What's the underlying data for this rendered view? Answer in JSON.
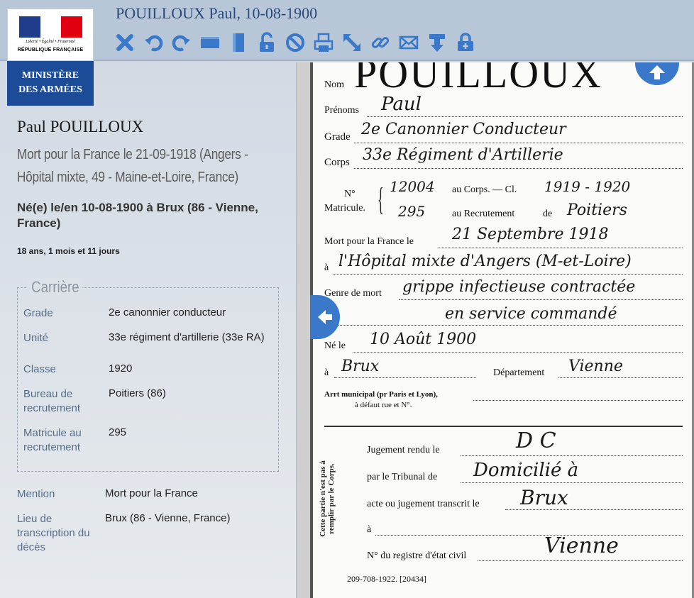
{
  "header": {
    "title": "POUILLOUX Paul, 10-08-1900",
    "tools": [
      {
        "name": "close-icon",
        "color": "#3a78c9"
      },
      {
        "name": "rotate-left-icon",
        "color": "#3a78c9"
      },
      {
        "name": "rotate-right-icon",
        "color": "#3a78c9"
      },
      {
        "name": "fit-width-icon",
        "color": "#3a78c9"
      },
      {
        "name": "fit-height-icon",
        "color": "#3a78c9"
      },
      {
        "name": "unlock-icon",
        "color": "#3a78c9"
      },
      {
        "name": "block-icon",
        "color": "#3a78c9"
      },
      {
        "name": "print-icon",
        "color": "#3a78c9"
      },
      {
        "name": "expand-icon",
        "color": "#3a78c9"
      },
      {
        "name": "link-icon",
        "color": "#3a78c9"
      },
      {
        "name": "mail-icon",
        "color": "#3a78c9"
      },
      {
        "name": "download-icon",
        "color": "#3a78c9"
      },
      {
        "name": "lock-add-icon",
        "color": "#3a78c9"
      }
    ]
  },
  "logo": {
    "motto": "Liberté • Égalité • Fraternité",
    "republic": "RÉPUBLIQUE FRANÇAISE",
    "ministry_line1": "MINISTÈRE",
    "ministry_line2": "DES ARMÉES"
  },
  "person": {
    "name": "Paul POUILLOUX",
    "mort": "Mort pour la France le 21-09-1918 (Angers - Hôpital mixte, 49 - Maine-et-Loire, France)",
    "naissance": "Né(e) le/en 10-08-1900 à Brux (86 - Vienne, France)",
    "age": "18 ans, 1 mois et 11 jours"
  },
  "carriere": {
    "title": "Carrière",
    "rows": [
      {
        "label": "Grade",
        "value": "2e canonnier conducteur"
      },
      {
        "label": "Unité",
        "value": "33e régiment d'artillerie (33e RA)"
      },
      {
        "label": "Classe",
        "value": "1920"
      },
      {
        "label": "Bureau de recrutement",
        "value": "Poitiers (86)"
      },
      {
        "label": "Matricule au recrutement",
        "value": "295"
      }
    ]
  },
  "extra": [
    {
      "label": "Mention",
      "value": "Mort pour la France"
    },
    {
      "label": "Lieu de transcription du décès",
      "value": "Brux (86 - Vienne, France)"
    }
  ],
  "document": {
    "nom_label": "Nom",
    "nom_value": "POUILLOUX",
    "prenoms_label": "Prénoms",
    "prenoms_value": "Paul",
    "grade_label": "Grade",
    "grade_value": "2e Canonnier Conducteur",
    "corps_label": "Corps",
    "corps_value": "33e Régiment d'Artillerie",
    "no_label": "N°",
    "matricule_label": "Matricule.",
    "corps_no": "12004",
    "au_corps": "au Corps. — Cl.",
    "classe": "1919 - 1920",
    "recr_no": "295",
    "au_recr": "au Recrutement",
    "de": "de",
    "recr_place": "Poitiers",
    "mort_label": "Mort pour la France le",
    "mort_date": "21 Septembre 1918",
    "a1": "à",
    "mort_lieu": "l'Hôpital mixte d'Angers (M-et-Loire)",
    "genre_label": "Genre de mort",
    "genre_value1": "grippe infectieuse contractée",
    "genre_value2": "en service commandé",
    "ne_label": "Né le",
    "ne_value": "10 Août 1900",
    "a2": "à",
    "ne_lieu": "Brux",
    "dept_label": "Département",
    "dept_value": "Vienne",
    "arr_label": "Arrt municipal (pr Paris et Lyon),",
    "arr_label2": "à défaut rue et N°.",
    "side_note": "Cette partie n'est pas à remplir par le Corps.",
    "jugement_label": "Jugement rendu le",
    "jugement_value": "D C",
    "tribunal_label": "par le Tribunal de",
    "tribunal_value": "Domicilié à",
    "transcrit_label": "acte ou jugement transcrit le",
    "transcrit_value": "Brux",
    "a3": "à",
    "registre_label": "N° du registre d'état civil",
    "registre_value": "Vienne",
    "footer": "209-708-1922.   [20434]"
  }
}
